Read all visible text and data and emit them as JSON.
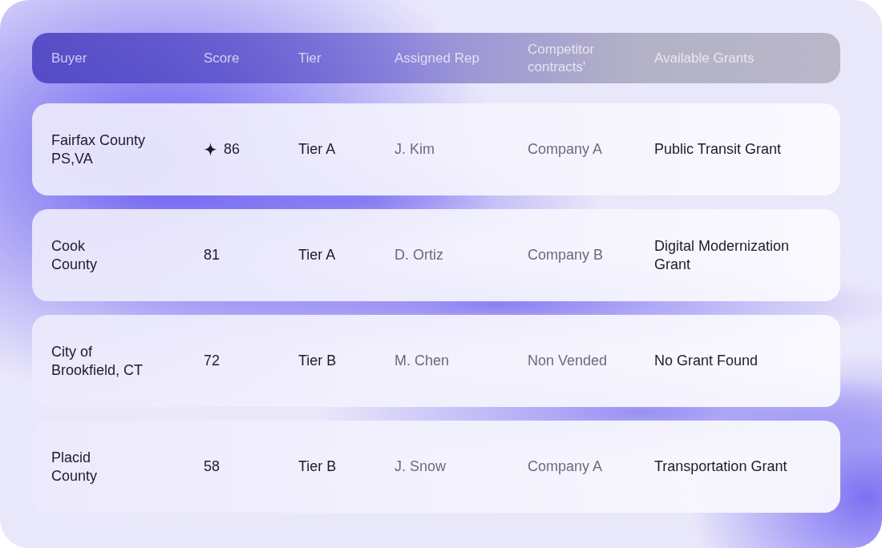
{
  "table": {
    "columns": [
      "Buyer",
      "Score",
      "Tier",
      "Assigned Rep",
      "Competitor\ncontracts'",
      "Available Grants"
    ],
    "rows": [
      {
        "buyer": "Fairfax County\nPS,VA",
        "starred": true,
        "score": "86",
        "tier": "Tier A",
        "rep": "J. Kim",
        "competitor": "Company A",
        "grant": "Public Transit Grant"
      },
      {
        "buyer": "Cook\nCounty",
        "starred": false,
        "score": "81",
        "tier": "Tier A",
        "rep": "D. Ortiz",
        "competitor": "Company B",
        "grant": "Digital Modernization\nGrant"
      },
      {
        "buyer": "City of\nBrookfield, CT",
        "starred": false,
        "score": "72",
        "tier": "Tier B",
        "rep": "M. Chen",
        "competitor": "Non Vended",
        "grant": "No Grant Found"
      },
      {
        "buyer": "Placid\nCounty",
        "starred": false,
        "score": "58",
        "tier": "Tier B",
        "rep": "J. Snow",
        "competitor": "Company A",
        "grant": "Transportation Grant"
      }
    ]
  }
}
